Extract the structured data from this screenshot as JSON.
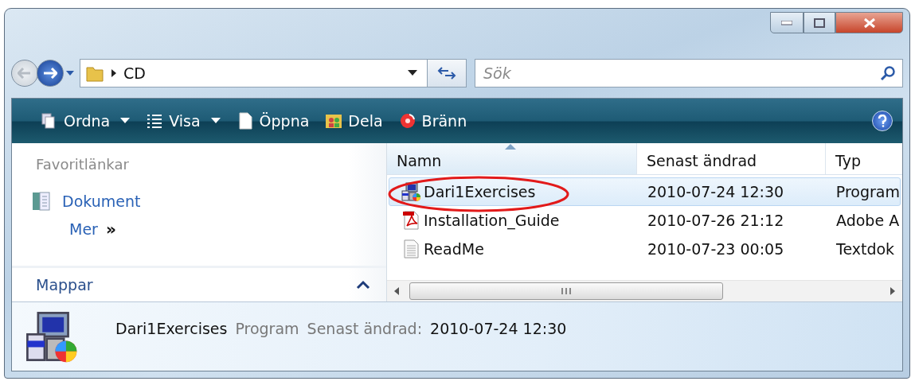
{
  "address": {
    "path": [
      "CD"
    ]
  },
  "search": {
    "placeholder": "Sök"
  },
  "toolbar": [
    {
      "label": "Ordna",
      "kind": "organize",
      "dropdown": true
    },
    {
      "label": "Visa",
      "kind": "views",
      "dropdown": true
    },
    {
      "label": "Öppna",
      "kind": "open",
      "dropdown": false
    },
    {
      "label": "Dela",
      "kind": "share",
      "dropdown": false
    },
    {
      "label": "Bränn",
      "kind": "burn",
      "dropdown": false
    }
  ],
  "nav": {
    "heading": "Favoritlänkar",
    "links": [
      {
        "label": "Dokument"
      }
    ],
    "more": "Mer",
    "more_glyph": "»",
    "folders": "Mappar"
  },
  "columns": [
    {
      "label": "Namn",
      "sorted": true
    },
    {
      "label": "Senast ändrad",
      "sorted": false
    },
    {
      "label": "Typ",
      "sorted": false
    }
  ],
  "rows": [
    {
      "name": "Dari1Exercises",
      "modified": "2010-07-24 12:30",
      "type": "Program",
      "kind": "program",
      "selected": true,
      "circled": true
    },
    {
      "name": "Installation_Guide",
      "modified": "2010-07-26 21:12",
      "type": "Adobe A",
      "kind": "pdf",
      "selected": false,
      "circled": false
    },
    {
      "name": "ReadMe",
      "modified": "2010-07-23 00:05",
      "type": "Textdok",
      "kind": "text",
      "selected": false,
      "circled": false
    }
  ],
  "details": {
    "name": "Dari1Exercises",
    "type": "Program",
    "modified_label": "Senast ändrad:",
    "modified": "2010-07-24 12:30",
    "kind": "program"
  }
}
